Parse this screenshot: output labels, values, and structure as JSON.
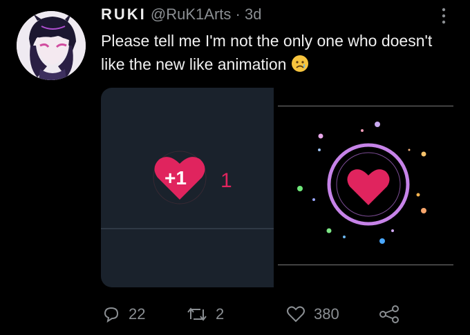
{
  "tweet": {
    "display_name": "RUKI",
    "handle": "@RuK1Arts",
    "separator": "·",
    "time": "3d",
    "text": "Please tell me I'm not the only one who doesn't like the new like animation"
  },
  "media": {
    "left": {
      "badge_text": "+1",
      "count": "1"
    }
  },
  "actions": {
    "replies": "22",
    "retweets": "2",
    "likes": "380"
  },
  "colors": {
    "background": "#000000",
    "like_red": "#e0245e",
    "ring_purple": "#c683e8",
    "media_panel": "#1a222c"
  },
  "icons": [
    "more-vertical-icon",
    "sad-face-emoji-icon",
    "reply-icon",
    "retweet-icon",
    "like-icon",
    "share-icon"
  ]
}
